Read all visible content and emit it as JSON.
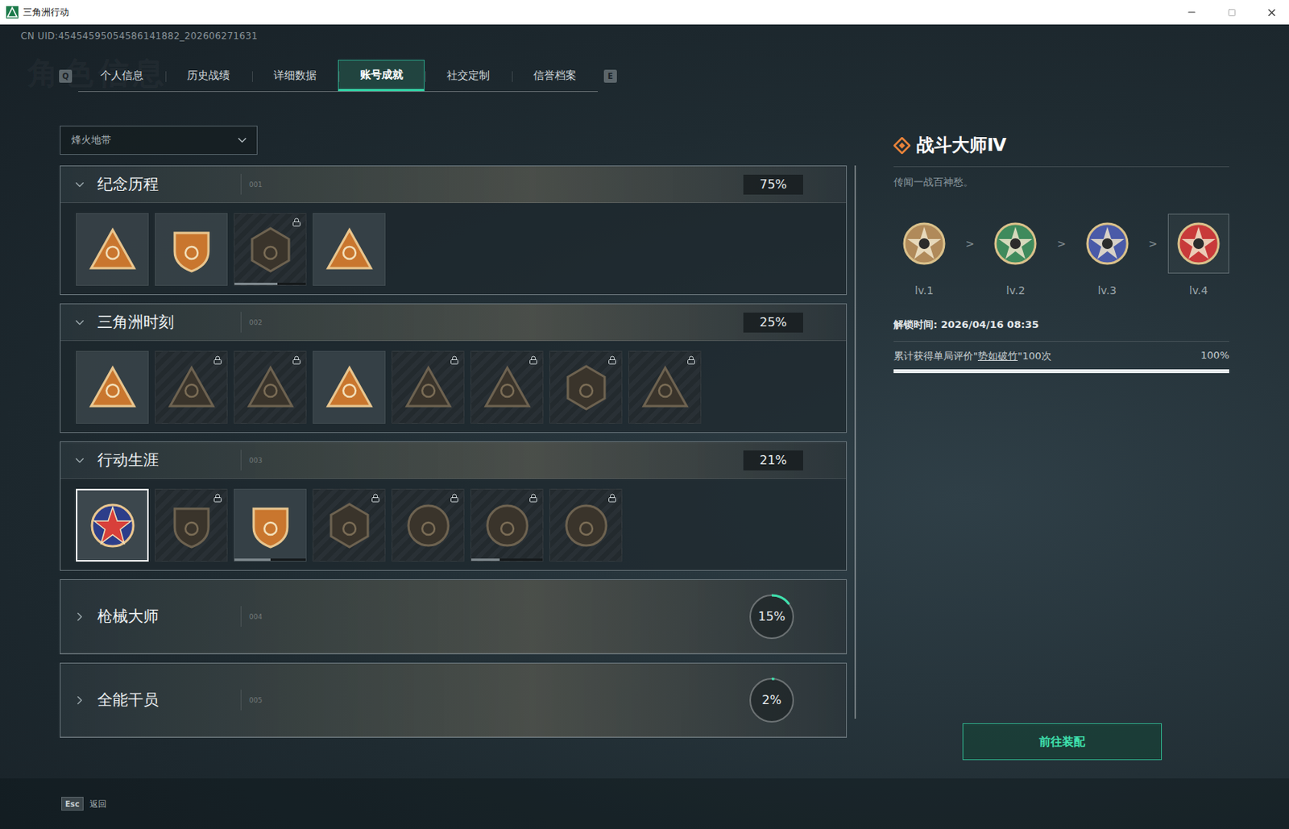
{
  "window": {
    "title": "三角洲行动"
  },
  "uid": "CN UID:45454595054586141882_202606271631",
  "watermark": "角色信息",
  "tabs": {
    "prev_key": "Q",
    "next_key": "E",
    "items": [
      {
        "label": "个人信息",
        "selected": false
      },
      {
        "label": "历史战绩",
        "selected": false
      },
      {
        "label": "详细数据",
        "selected": false
      },
      {
        "label": "账号成就",
        "selected": true
      },
      {
        "label": "社交定制",
        "selected": false
      },
      {
        "label": "信誉档案",
        "selected": false
      }
    ]
  },
  "mode_select": {
    "value": "烽火地带"
  },
  "sections": [
    {
      "title": "纪念历程",
      "code": "001",
      "percent": "75%",
      "expanded": true,
      "badges": [
        {
          "locked": false,
          "selected": false
        },
        {
          "locked": false,
          "selected": false
        },
        {
          "locked": true,
          "selected": false,
          "level": 0.6
        },
        {
          "locked": false,
          "selected": false
        }
      ]
    },
    {
      "title": "三角洲时刻",
      "code": "002",
      "percent": "25%",
      "expanded": true,
      "badges": [
        {
          "locked": false,
          "selected": false
        },
        {
          "locked": true,
          "selected": false
        },
        {
          "locked": true,
          "selected": false
        },
        {
          "locked": false,
          "selected": false
        },
        {
          "locked": true,
          "selected": false
        },
        {
          "locked": true,
          "selected": false
        },
        {
          "locked": true,
          "selected": false
        },
        {
          "locked": true,
          "selected": false
        }
      ]
    },
    {
      "title": "行动生涯",
      "code": "003",
      "percent": "21%",
      "expanded": true,
      "badges": [
        {
          "locked": false,
          "selected": true
        },
        {
          "locked": true,
          "selected": false
        },
        {
          "locked": false,
          "selected": false,
          "level": 0.5
        },
        {
          "locked": true,
          "selected": false
        },
        {
          "locked": true,
          "selected": false
        },
        {
          "locked": true,
          "selected": false,
          "level": 0.4
        },
        {
          "locked": true,
          "selected": false
        }
      ]
    },
    {
      "title": "枪械大师",
      "code": "004",
      "percent": "15%",
      "expanded": false,
      "level": 0.15,
      "badges": []
    },
    {
      "title": "全能干员",
      "code": "005",
      "percent": "2%",
      "expanded": false,
      "level": 0.02,
      "badges": []
    }
  ],
  "detail": {
    "title": "战斗大师Ⅳ",
    "subtitle": "传闻一战百神愁。",
    "separator": ">",
    "levels": [
      {
        "label": "lv.1",
        "selected": false,
        "color": "#b08a5a"
      },
      {
        "label": "lv.2",
        "selected": false,
        "color": "#3f8a5c"
      },
      {
        "label": "lv.3",
        "selected": false,
        "color": "#4a5aa8"
      },
      {
        "label": "lv.4",
        "selected": true,
        "color": "#c83a3a"
      }
    ],
    "unlock_time": "解锁时间: 2026/04/16 08:35",
    "requirement": {
      "prefix": "累计获得单局评价\"",
      "highlight": "势如破竹",
      "suffix": "\"100次",
      "percent": "100%",
      "level": 1
    },
    "button": "前往装配"
  },
  "footer": {
    "key": "Esc",
    "label": "返回"
  }
}
